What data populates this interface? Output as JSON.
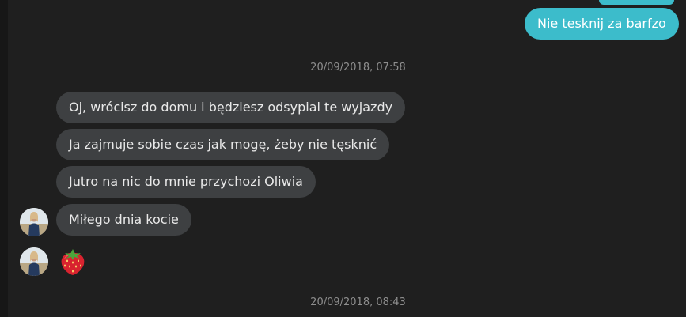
{
  "conversation": {
    "outgoing_message": "Nie tesknij za barfzo",
    "timestamps": [
      "20/09/2018, 07:58",
      "20/09/2018, 08:43"
    ],
    "incoming_messages": [
      "Oj, wrócisz do domu i będziesz odsypial te wyjazdy",
      "Ja zajmuje sobie czas jak mogę, żeby nie tęsknić",
      "Jutro na nic do mnie przychozi Oliwia",
      "Miłego dnia kocie"
    ],
    "emoji_message": "strawberry-emoji"
  },
  "colors": {
    "background": "#1f1f1f",
    "incoming_bubble": "#3e4042",
    "outgoing_bubble": "#3cbccb",
    "timestamp_text": "#8e8e8e"
  }
}
